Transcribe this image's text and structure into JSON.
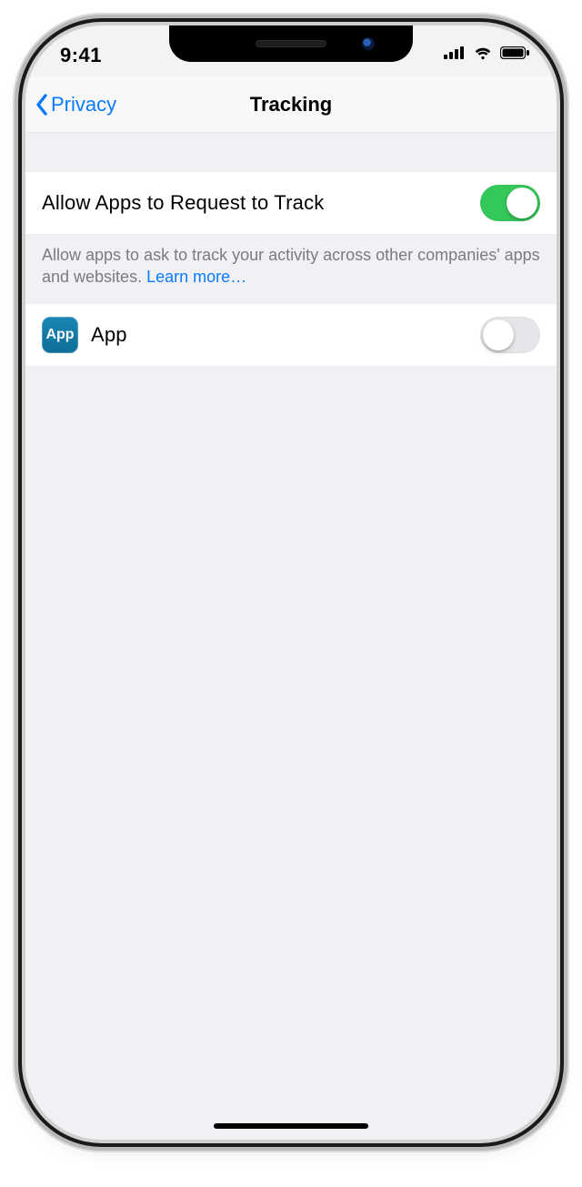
{
  "status": {
    "time": "9:41"
  },
  "nav": {
    "back_label": "Privacy",
    "title": "Tracking"
  },
  "settings": {
    "allow_row": {
      "label": "Allow Apps to Request to Track",
      "on": true
    },
    "footer": {
      "text": "Allow apps to ask to track your activity across other companies' apps and websites. ",
      "link": "Learn more…"
    },
    "apps": [
      {
        "name": "App",
        "icon_label": "App",
        "on": false
      }
    ]
  }
}
